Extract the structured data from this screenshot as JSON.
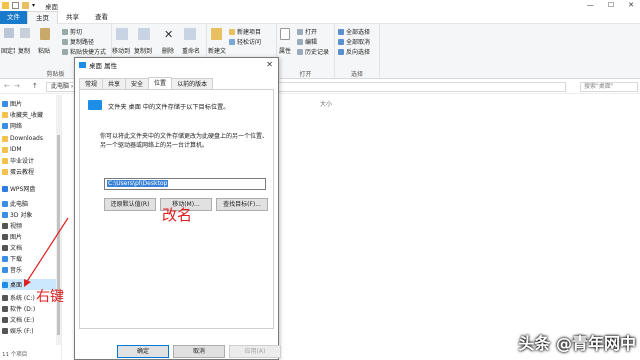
{
  "window": {
    "title": "桌面",
    "controls": [
      "—",
      "☐",
      "✕"
    ]
  },
  "ribbon_tabs": [
    {
      "label": "文件"
    },
    {
      "label": "主页"
    },
    {
      "label": "共享"
    },
    {
      "label": "查看"
    }
  ],
  "ribbon": {
    "clipboard": {
      "pin": "固定到快速访问",
      "copy": "复制",
      "paste": "粘贴",
      "cut": "剪切",
      "copy_path": "复制路径",
      "paste_shortcut": "粘贴快捷方式",
      "group_label": "剪贴板"
    },
    "organize": {
      "move_to": "移动到",
      "copy_to": "复制到",
      "delete": "删除",
      "rename": "重命名"
    },
    "new": {
      "new_folder": "新建文件夹",
      "new_item": "新建项目",
      "easy_access": "轻松访问"
    },
    "open": {
      "properties": "属性",
      "open": "打开",
      "edit": "编辑",
      "history": "历史记录",
      "group_label": "打开"
    },
    "select": {
      "select_all": "全部选择",
      "select_none": "全部取消",
      "invert": "反向选择",
      "group_label": "选择"
    }
  },
  "address": {
    "path": "此电脑 › 桌面",
    "search_placeholder": "搜索\"桌面\""
  },
  "nav": {
    "items": [
      {
        "label": "图片",
        "color": "#3a8ee6"
      },
      {
        "label": "收藏夹_收藏",
        "color": "#f2c24b"
      },
      {
        "label": "网络",
        "color": "#3a8ee6"
      },
      {
        "label": "Downloads",
        "color": "#f2c24b"
      },
      {
        "label": "IDM",
        "color": "#f2c24b"
      },
      {
        "label": "毕业设计",
        "color": "#f2c24b"
      },
      {
        "label": "蛋云教程",
        "color": "#f2c24b"
      },
      {
        "label": "WPS网盘",
        "color": "#2f7de1"
      },
      {
        "label": "此电脑",
        "color": "#3a8ee6"
      },
      {
        "label": "3D 对象",
        "color": "#3a8ee6"
      },
      {
        "label": "视频",
        "color": "#555555"
      },
      {
        "label": "图片",
        "color": "#555555"
      },
      {
        "label": "文档",
        "color": "#555555"
      },
      {
        "label": "下载",
        "color": "#3a8ee6"
      },
      {
        "label": "音乐",
        "color": "#3a8ee6"
      },
      {
        "label": "桌面",
        "color": "#1c8ee6"
      },
      {
        "label": "系统 (C:)",
        "color": "#555555"
      },
      {
        "label": "软件 (D:)",
        "color": "#555555"
      },
      {
        "label": "文档 (E:)",
        "color": "#555555"
      },
      {
        "label": "娱乐 (F:)",
        "color": "#555555"
      }
    ]
  },
  "list": {
    "size_header": "大小"
  },
  "status": {
    "count": "11 个项目"
  },
  "dialog": {
    "title": "桌面 属性",
    "tabs": [
      {
        "label": "常规"
      },
      {
        "label": "共享"
      },
      {
        "label": "安全"
      },
      {
        "label": "位置"
      },
      {
        "label": "以前的版本"
      }
    ],
    "desc1": "文件夹 桌面 中的文件存储于以下目标位置。",
    "desc2": "你可以将此文件夹中的文件存储更改为此硬盘上的另一个位置、另一个驱动器或网络上的另一台计算机。",
    "path_value": "C:\\Users\\pl\\Desktop",
    "restore_default": "还原默认值(R)",
    "move": "移动(M)...",
    "find_target": "查找目标(F)...",
    "ok": "确定",
    "cancel": "取消",
    "apply": "应用(A)"
  },
  "annotations": {
    "rename_note": "改名",
    "right_click_note": "右键",
    "color": "#e02020"
  },
  "watermark": "头条 @青年网中"
}
